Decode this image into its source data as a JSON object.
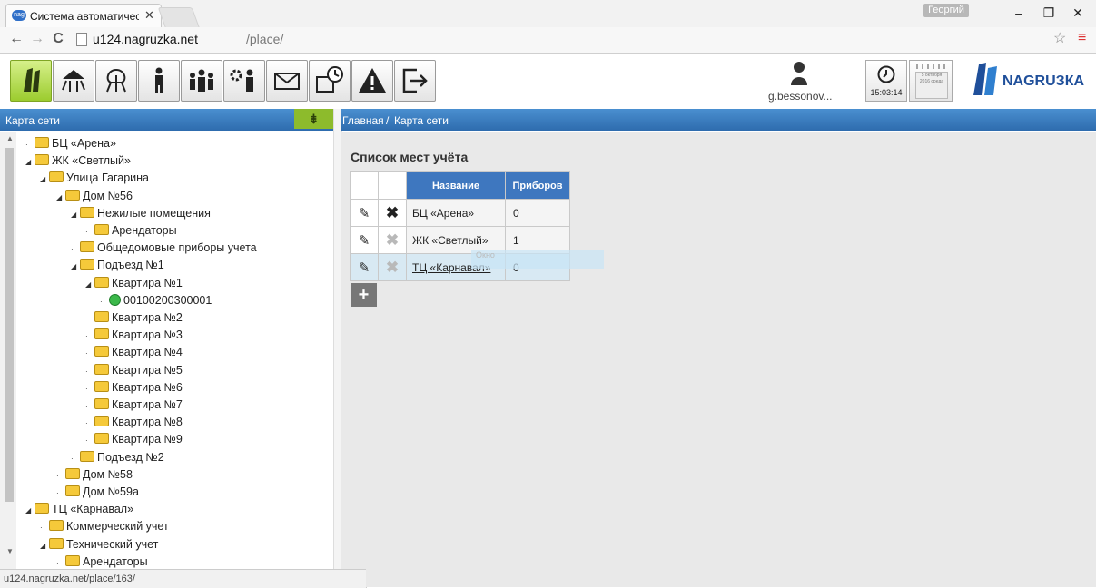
{
  "browser": {
    "tab_title": "Система автоматическог",
    "tab_favicon": "nag",
    "profile": "Георгий",
    "url_host": "u124.nagruzka.net",
    "url_path": "/place/",
    "status_url": "u124.nagruzka.net/place/163/"
  },
  "toolbar": {
    "icons": [
      "map-icon",
      "network-icon",
      "tree-icon",
      "person-icon",
      "group-icon",
      "person-gear-icon",
      "mail-icon",
      "report-clock-icon",
      "warning-icon",
      "logout-icon"
    ],
    "user": "g.bessonov...",
    "time": "15:03:14",
    "calendar": "5 октября 2016 среда",
    "logo_text": "NAGRU",
    "logo_text2": "ЗКА",
    "colors": {
      "accent": "#8dbb2c",
      "header": "#3579bd",
      "logo": "#1f4f9a"
    }
  },
  "left_panel": {
    "title": "Карта сети",
    "tree": [
      {
        "label": "БЦ «Арена»",
        "level": 1,
        "type": "folder"
      },
      {
        "label": "ЖК «Светлый»",
        "level": 1,
        "type": "folder",
        "expanded": true
      },
      {
        "label": "Улица Гагарина",
        "level": 2,
        "type": "folder",
        "expanded": true
      },
      {
        "label": "Дом №56",
        "level": 3,
        "type": "folder",
        "expanded": true
      },
      {
        "label": "Нежилые помещения",
        "level": 4,
        "type": "folder",
        "expanded": true
      },
      {
        "label": "Арендаторы",
        "level": 5,
        "type": "folder"
      },
      {
        "label": "Общедомовые приборы учета",
        "level": 4,
        "type": "folder"
      },
      {
        "label": "Подъезд №1",
        "level": 4,
        "type": "folder",
        "expanded": true
      },
      {
        "label": "Квартира №1",
        "level": 5,
        "type": "folder",
        "expanded": true
      },
      {
        "label": "00100200300001",
        "level": 6,
        "type": "meter"
      },
      {
        "label": "Квартира №2",
        "level": 5,
        "type": "folder"
      },
      {
        "label": "Квартира №3",
        "level": 5,
        "type": "folder"
      },
      {
        "label": "Квартира №4",
        "level": 5,
        "type": "folder"
      },
      {
        "label": "Квартира №5",
        "level": 5,
        "type": "folder"
      },
      {
        "label": "Квартира №6",
        "level": 5,
        "type": "folder"
      },
      {
        "label": "Квартира №7",
        "level": 5,
        "type": "folder"
      },
      {
        "label": "Квартира №8",
        "level": 5,
        "type": "folder"
      },
      {
        "label": "Квартира №9",
        "level": 5,
        "type": "folder"
      },
      {
        "label": "Подъезд №2",
        "level": 4,
        "type": "folder"
      },
      {
        "label": "Дом №58",
        "level": 3,
        "type": "folder"
      },
      {
        "label": "Дом №59а",
        "level": 3,
        "type": "folder"
      },
      {
        "label": "ТЦ «Карнавал»",
        "level": 1,
        "type": "folder",
        "expanded": true
      },
      {
        "label": "Коммерческий учет",
        "level": 2,
        "type": "folder"
      },
      {
        "label": "Технический учет",
        "level": 2,
        "type": "folder",
        "expanded": true
      },
      {
        "label": "Арендаторы",
        "level": 3,
        "type": "folder"
      }
    ]
  },
  "breadcrumb": {
    "home": "Главная",
    "sep": "/",
    "current": "Карта сети"
  },
  "main": {
    "list_title": "Список мест учёта",
    "columns": [
      "Название",
      "Приборов"
    ],
    "rows": [
      {
        "name": "БЦ «Арена»",
        "count": "0",
        "delete_enabled": true
      },
      {
        "name": "ЖК «Светлый»",
        "count": "1",
        "delete_enabled": false
      },
      {
        "name": "ТЦ «Карнавал»",
        "count": "0",
        "delete_enabled": false,
        "highlight": true,
        "link": true
      }
    ],
    "tooltip": "Окно",
    "add_label": "+"
  }
}
